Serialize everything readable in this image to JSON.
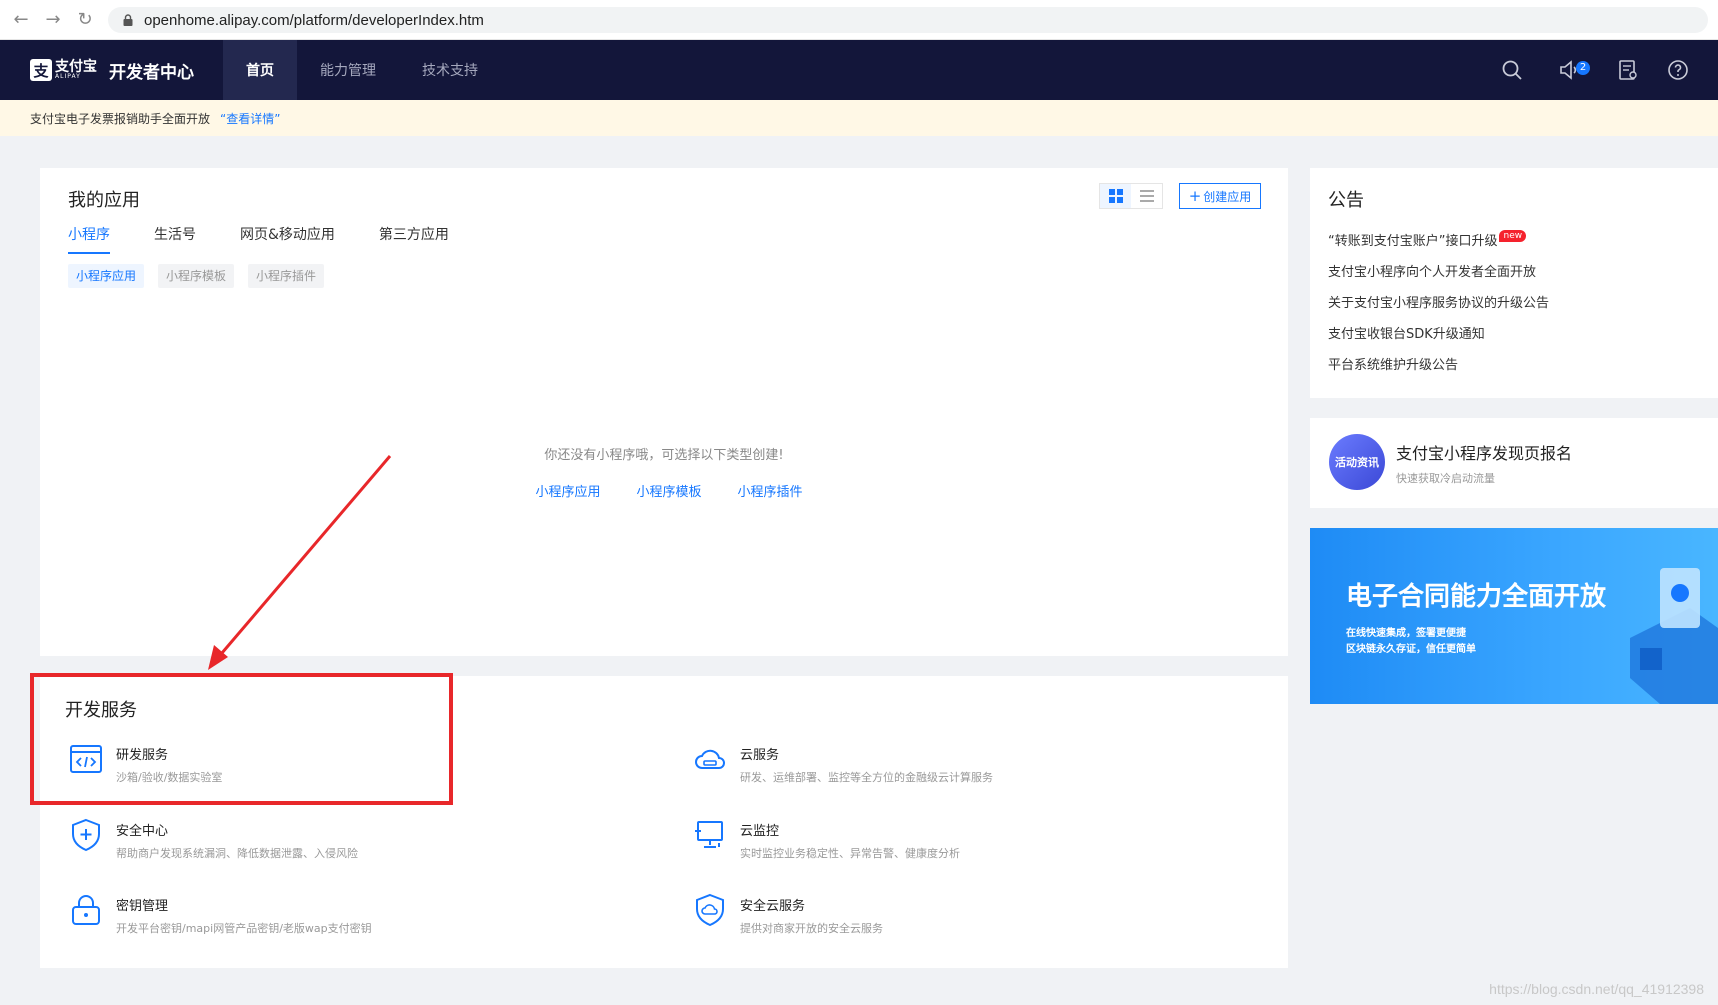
{
  "browser": {
    "url": "openhome.alipay.com/platform/developerIndex.htm"
  },
  "topnav": {
    "logo_cn": "支付宝",
    "logo_en": "ALIPAY",
    "title": "开发者中心",
    "tabs": [
      {
        "label": "首页"
      },
      {
        "label": "能力管理"
      },
      {
        "label": "技术支持"
      }
    ],
    "message_count": "2"
  },
  "notice": {
    "text": "支付宝电子发票报销助手全面开放",
    "link": "“查看详情”"
  },
  "my_apps": {
    "title": "我的应用",
    "create_label": "创建应用",
    "tabs": [
      {
        "label": "小程序"
      },
      {
        "label": "生活号"
      },
      {
        "label": "网页&移动应用"
      },
      {
        "label": "第三方应用"
      }
    ],
    "chips": [
      {
        "label": "小程序应用"
      },
      {
        "label": "小程序模板"
      },
      {
        "label": "小程序插件"
      }
    ],
    "empty_message": "你还没有小程序哦，可选择以下类型创建!",
    "empty_links": [
      {
        "label": "小程序应用"
      },
      {
        "label": "小程序模板"
      },
      {
        "label": "小程序插件"
      }
    ]
  },
  "dev_services": {
    "title": "开发服务",
    "items": [
      {
        "name": "研发服务",
        "desc": "沙箱/验收/数据实验室"
      },
      {
        "name": "云服务",
        "desc": "研发、运维部署、监控等全方位的金融级云计算服务"
      },
      {
        "name": "安全中心",
        "desc": "帮助商户发现系统漏洞、降低数据泄露、入侵风险"
      },
      {
        "name": "云监控",
        "desc": "实时监控业务稳定性、异常告警、健康度分析"
      },
      {
        "name": "密钥管理",
        "desc": "开发平台密钥/mapi网管产品密钥/老版wap支付密钥"
      },
      {
        "name": "安全云服务",
        "desc": "提供对商家开放的安全云服务"
      }
    ]
  },
  "announcements": {
    "title": "公告",
    "new_tag": "new",
    "items": [
      {
        "text": "“转账到支付宝账户”接口升级"
      },
      {
        "text": "支付宝小程序向个人开发者全面开放"
      },
      {
        "text": "关于支付宝小程序服务协议的升级公告"
      },
      {
        "text": "支付宝收银台SDK升级通知"
      },
      {
        "text": "平台系统维护升级公告"
      }
    ]
  },
  "activity": {
    "badge": "活动资讯",
    "title": "支付宝小程序发现页报名",
    "subtitle": "快速获取冷启动流量"
  },
  "banner": {
    "title": "电子合同能力全面开放",
    "line1": "在线快速集成，签署更便捷",
    "line2": "区块链永久存证，信任更简单"
  },
  "watermark": "https://blog.csdn.net/qq_41912398",
  "colors": {
    "brand": "#1677ff",
    "nav_bg": "#13163a",
    "highlight": "#e8272a"
  }
}
